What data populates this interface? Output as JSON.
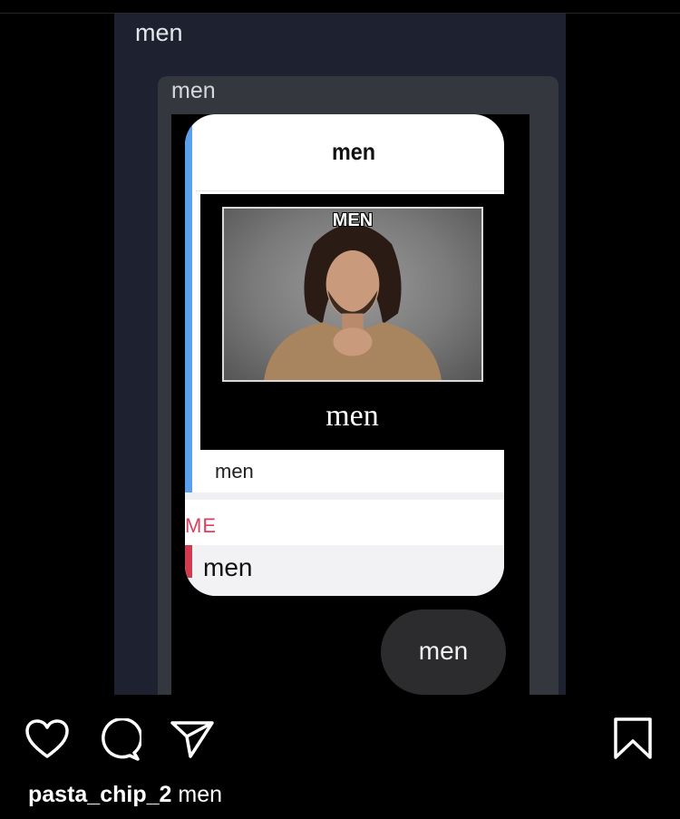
{
  "post": {
    "panel_text": "men",
    "quote_text": "men",
    "phone": {
      "title": "men",
      "image_caption": "MEN",
      "poster_text": "men",
      "caption": "men",
      "section_label": "ME",
      "reply_text": "men"
    },
    "bubble_text": "men"
  },
  "actions": {
    "like_icon": "heart-icon",
    "comment_icon": "comment-icon",
    "share_icon": "send-icon",
    "save_icon": "bookmark-icon"
  },
  "caption": {
    "username": "pasta_chip_2",
    "text": "men"
  }
}
